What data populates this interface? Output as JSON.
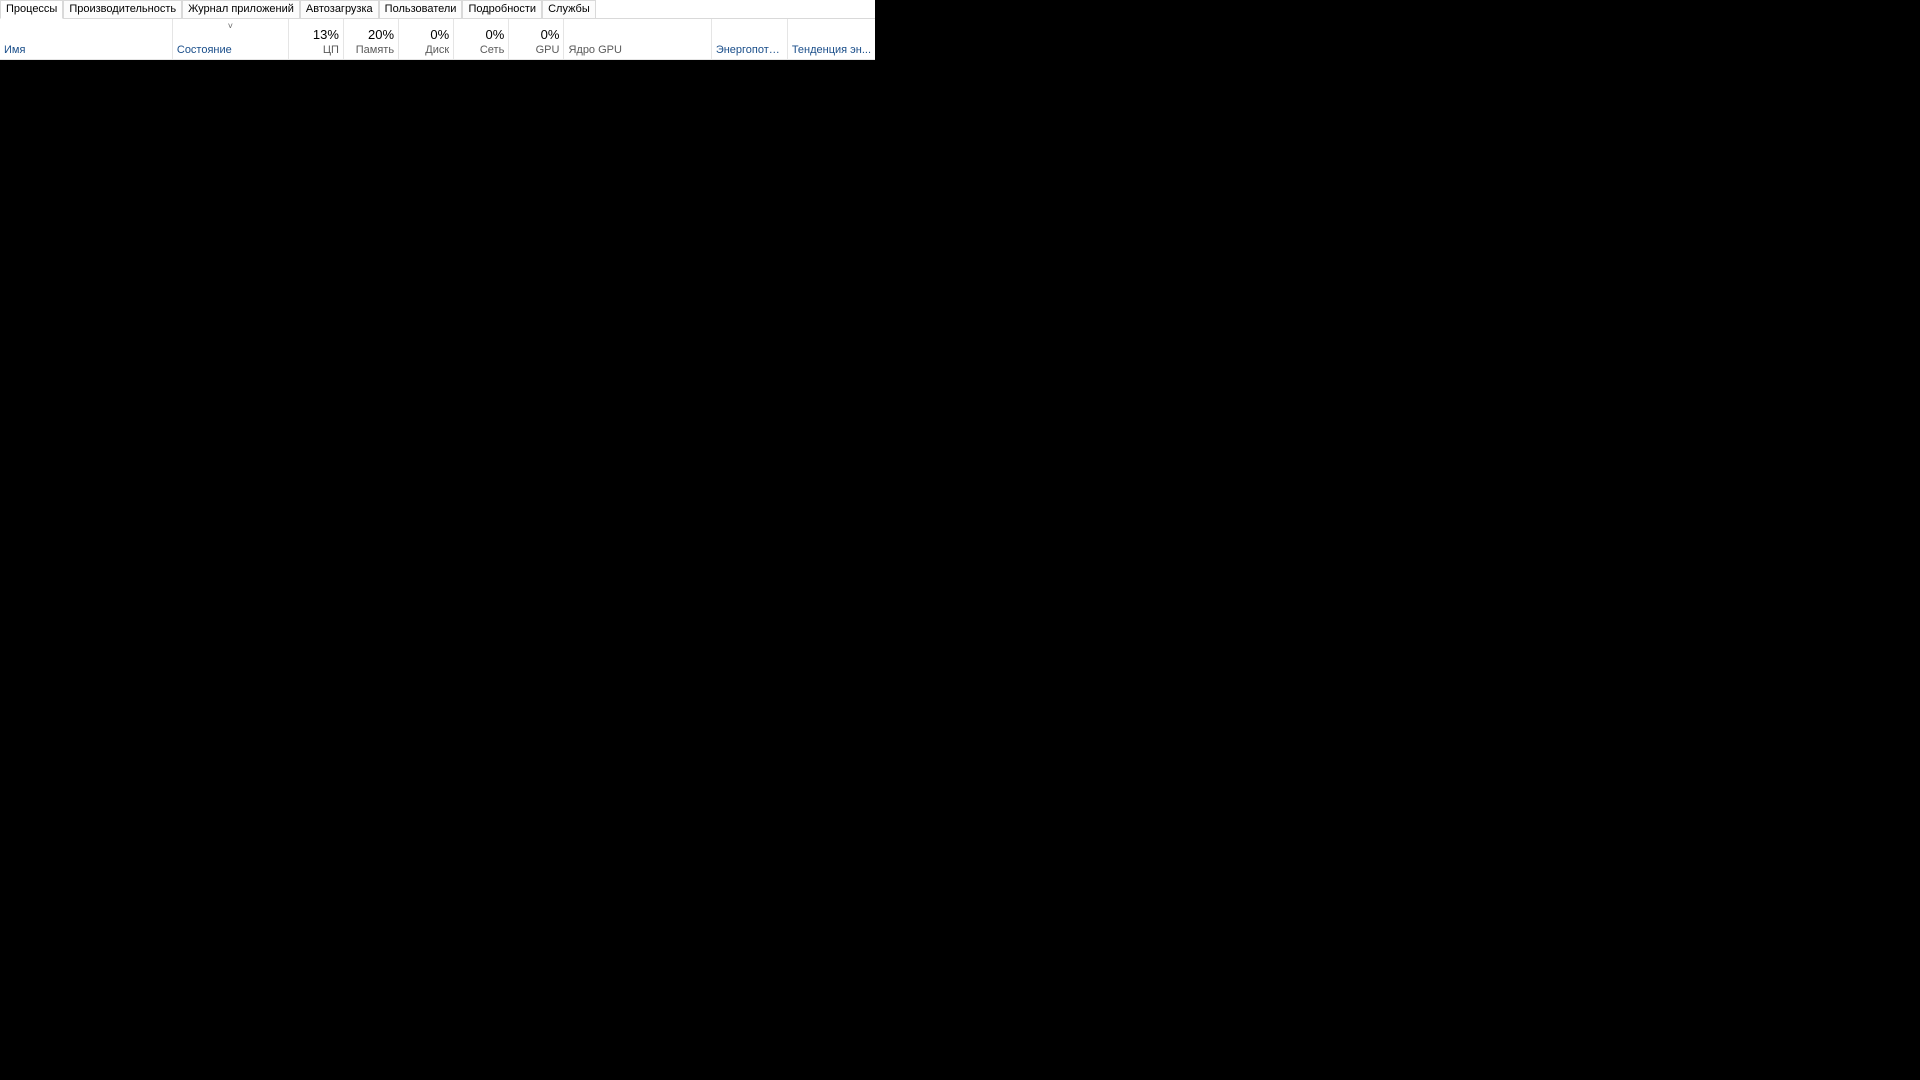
{
  "tabs": {
    "processes": "Процессы",
    "performance": "Производительность",
    "app_history": "Журнал приложений",
    "startup": "Автозагрузка",
    "users": "Пользователи",
    "details": "Подробности",
    "services": "Службы"
  },
  "columns": {
    "name": {
      "label": "Имя"
    },
    "state": {
      "label": "Состояние",
      "sort": "˅"
    },
    "cpu": {
      "value": "13%",
      "label": "ЦП"
    },
    "memory": {
      "value": "20%",
      "label": "Память"
    },
    "disk": {
      "value": "0%",
      "label": "Диск"
    },
    "network": {
      "value": "0%",
      "label": "Сеть"
    },
    "gpu": {
      "value": "0%",
      "label": "GPU"
    },
    "gpucore": {
      "label": "Ядро GPU"
    },
    "power": {
      "label": "Энергопотре..."
    },
    "trend": {
      "label": "Тенденция эн..."
    }
  }
}
